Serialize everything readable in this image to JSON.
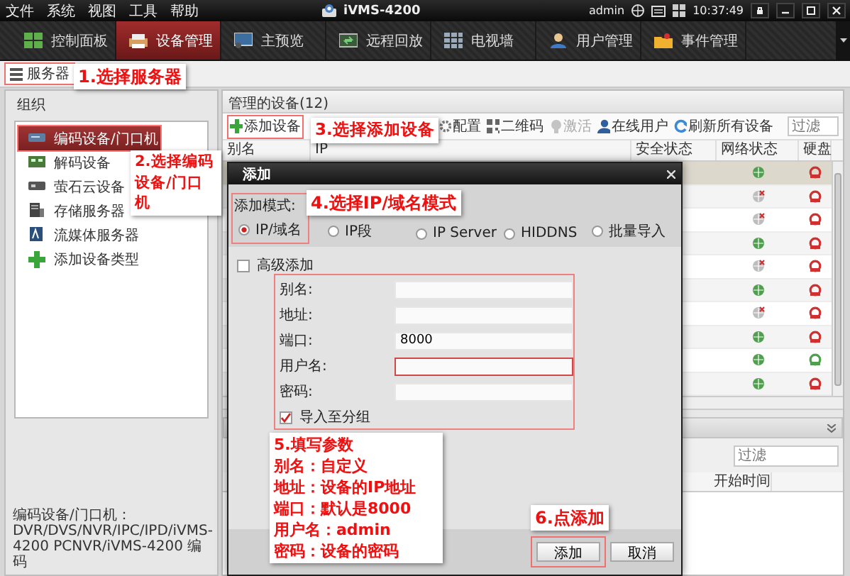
{
  "menu": [
    {
      "label": "文件"
    },
    {
      "label": "系统"
    },
    {
      "label": "视图"
    },
    {
      "label": "工具"
    },
    {
      "label": "帮助"
    }
  ],
  "app_title": "iVMS-4200",
  "user": "admin",
  "clock": "10:37:49",
  "nav_tabs": [
    {
      "label": "控制面板",
      "selected": false
    },
    {
      "label": "设备管理",
      "selected": true
    },
    {
      "label": "主预览",
      "selected": false
    },
    {
      "label": "远程回放",
      "selected": false
    },
    {
      "label": "电视墙",
      "selected": false
    },
    {
      "label": "用户管理",
      "selected": false
    },
    {
      "label": "事件管理",
      "selected": false
    }
  ],
  "sub_tabs": [
    {
      "label": "服务器",
      "selected": true
    }
  ],
  "tree": {
    "title": "组织",
    "items": [
      {
        "label": "编码设备/门口机",
        "kind": "encoder",
        "selected": true
      },
      {
        "label": "解码设备",
        "kind": "decoder",
        "selected": false
      },
      {
        "label": "萤石云设备",
        "kind": "cloud",
        "selected": false
      },
      {
        "label": "存储服务器",
        "kind": "storage",
        "selected": false
      },
      {
        "label": "流媒体服务器",
        "kind": "stream",
        "selected": false
      },
      {
        "label": "添加设备类型",
        "kind": "add",
        "selected": false
      }
    ],
    "description": "编码设备/门口机：DVR/DVS/NVR/IPC/IPD/iVMS-4200 PCNVR/iVMS-4200 编码"
  },
  "devices": {
    "title": "管理的设备(12)",
    "toolbar": [
      {
        "label": "添加设备",
        "kind": "add",
        "disabled": false
      },
      {
        "label": "配置",
        "kind": "config",
        "disabled": false
      },
      {
        "label": "二维码",
        "kind": "qrcode",
        "disabled": false
      },
      {
        "label": "激活",
        "kind": "activate",
        "disabled": true
      },
      {
        "label": "在线用户",
        "kind": "online_users",
        "disabled": false
      },
      {
        "label": "刷新所有设备",
        "kind": "refresh",
        "disabled": false
      }
    ],
    "filter": {
      "placeholder": "过滤"
    },
    "columns": [
      {
        "label": "别名"
      },
      {
        "label": "IP"
      },
      {
        "label": "安全状态"
      },
      {
        "label": "网络状态"
      },
      {
        "label": "硬盘"
      }
    ],
    "rows": [
      {
        "selected": true,
        "online": true,
        "hdd_ok": false
      },
      {
        "selected": false,
        "online": false,
        "hdd_ok": false
      },
      {
        "selected": false,
        "online": false,
        "hdd_ok": false
      },
      {
        "selected": false,
        "online": true,
        "hdd_ok": false
      },
      {
        "selected": false,
        "online": false,
        "hdd_ok": false
      },
      {
        "selected": false,
        "online": true,
        "hdd_ok": false
      },
      {
        "selected": false,
        "online": false,
        "hdd_ok": false
      },
      {
        "selected": false,
        "online": true,
        "hdd_ok": false
      },
      {
        "selected": false,
        "online": true,
        "hdd_ok": true
      },
      {
        "selected": false,
        "online": true,
        "hdd_ok": false
      }
    ]
  },
  "events": {
    "filter": {
      "placeholder": "过滤"
    },
    "columns": [
      {
        "label": "开始时间"
      }
    ]
  },
  "dialog": {
    "title": "添加",
    "mode_label": "添加模式:",
    "modes": [
      {
        "label": "IP/域名",
        "selected": true
      },
      {
        "label": "IP段",
        "selected": false
      },
      {
        "label": "IP Server",
        "selected": false
      },
      {
        "label": "HIDDNS",
        "selected": false
      },
      {
        "label": "批量导入",
        "selected": false
      }
    ],
    "advanced": {
      "label": "高级添加",
      "checked": false
    },
    "fields": [
      {
        "label": "别名:",
        "focused": false
      },
      {
        "label": "地址:",
        "focused": false
      },
      {
        "label": "端口:",
        "value": "8000",
        "focused": false
      },
      {
        "label": "用户名:",
        "focused": true
      },
      {
        "label": "密码:",
        "focused": false
      }
    ],
    "group_import": {
      "label": "导入至分组",
      "checked": true
    },
    "buttons": [
      {
        "label": "添加"
      },
      {
        "label": "取消"
      }
    ]
  },
  "annotations": [
    {
      "lines": [
        "1.选择服务器"
      ]
    },
    {
      "lines": [
        "2.选择编码设备/门口机"
      ]
    },
    {
      "lines": [
        "3.选择添加设备"
      ]
    },
    {
      "lines": [
        "4.选择IP/域名模式"
      ]
    },
    {
      "lines": [
        "5.填写参数",
        "别名：自定义",
        "地址：设备的IP地址",
        "端口：默认是8000",
        "用户名：admin",
        "密码：设备的密码"
      ]
    },
    {
      "lines": [
        "6.点添加"
      ]
    }
  ]
}
